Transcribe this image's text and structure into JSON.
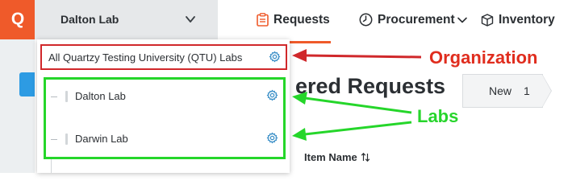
{
  "brand": {
    "logo_letter": "Q",
    "color": "#ef5a2a"
  },
  "lab_switcher": {
    "selected": "Dalton Lab",
    "icon": "chevron-down-icon"
  },
  "nav": {
    "requests": "Requests",
    "procurement": "Procurement",
    "inventory": "Inventory",
    "active_color": "#ef5a2a"
  },
  "page": {
    "title": "ered Requests",
    "tab_new_label": "New",
    "tab_new_count": "1",
    "column_item_name": "Item Name"
  },
  "dropdown": {
    "organization": "All Quartzy Testing University (QTU) Labs",
    "labs": [
      {
        "label": "Dalton Lab"
      },
      {
        "label": "Darwin Lab"
      }
    ]
  },
  "annotations": {
    "organization": "Organization",
    "labs": "Labs",
    "org_color": "#e02d1e",
    "labs_color": "#27d52c"
  }
}
